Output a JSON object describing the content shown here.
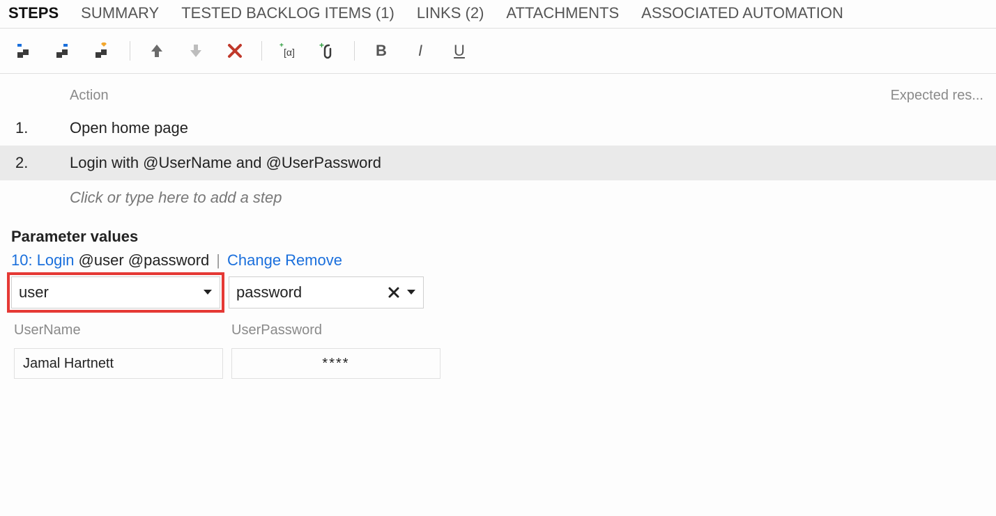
{
  "tabs": [
    {
      "label": "STEPS",
      "active": true
    },
    {
      "label": "SUMMARY"
    },
    {
      "label": "TESTED BACKLOG ITEMS (1)"
    },
    {
      "label": "LINKS (2)"
    },
    {
      "label": "ATTACHMENTS"
    },
    {
      "label": "ASSOCIATED AUTOMATION"
    }
  ],
  "toolbar": {
    "bold": "B",
    "italic": "I",
    "underline": "U"
  },
  "steps_header": {
    "action": "Action",
    "expected": "Expected res..."
  },
  "steps": [
    {
      "num": "1.",
      "action": "Open home page",
      "selected": false
    },
    {
      "num": "2.",
      "action": "Login with  @UserName and  @UserPassword",
      "selected": true
    }
  ],
  "steps_placeholder": "Click or type here to add a step",
  "params": {
    "title": "Parameter values",
    "link_text": "10: Login",
    "link_suffix": " @user @password",
    "change": "Change",
    "remove": "Remove",
    "dropdowns": [
      {
        "label": "user",
        "hasClear": false,
        "highlighted": true
      },
      {
        "label": "password",
        "hasClear": true,
        "highlighted": false
      }
    ],
    "columns": [
      "UserName",
      "UserPassword"
    ],
    "row": [
      "Jamal Hartnett",
      "****"
    ]
  }
}
